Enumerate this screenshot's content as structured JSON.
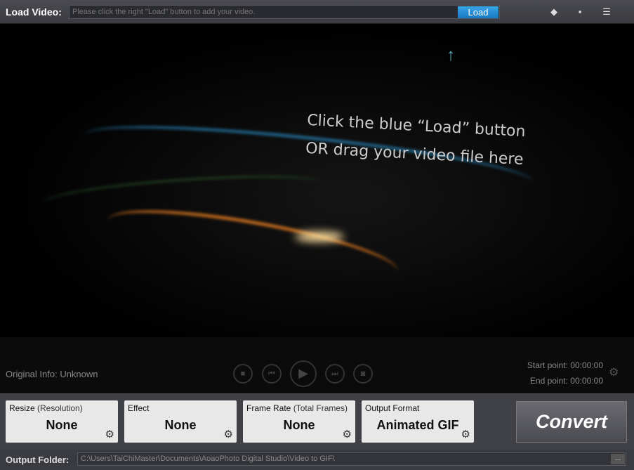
{
  "top": {
    "label": "Load Video:",
    "placeholder": "Please click the right \"Load\" button to add your video.",
    "load": "Load",
    "icons": [
      "tag-icon",
      "comment-icon",
      "notes-icon"
    ]
  },
  "video": {
    "hint1": "Click the blue “Load” button",
    "hint2": "OR drag your video file here"
  },
  "controls": {
    "original_info": "Original Info: Unknown",
    "start": "Start point: 00:00:00",
    "end": "End point: 00:00:00",
    "buttons": [
      "stop",
      "previous",
      "play",
      "next",
      "snapshot"
    ]
  },
  "settings": [
    {
      "title": "Resize",
      "sub": " (Resolution)",
      "value": "None"
    },
    {
      "title": "Effect",
      "sub": "",
      "value": "None"
    },
    {
      "title": "Frame Rate",
      "sub": " (Total Frames)",
      "value": "None"
    },
    {
      "title": "Output Format",
      "sub": "",
      "value": "Animated GIF"
    }
  ],
  "convert": "Convert",
  "output": {
    "label": "Output Folder:",
    "path": "C:\\Users\\TaiChiMaster\\Documents\\AoaoPhoto Digital Studio\\Video to GIF\\",
    "browse": "..."
  }
}
